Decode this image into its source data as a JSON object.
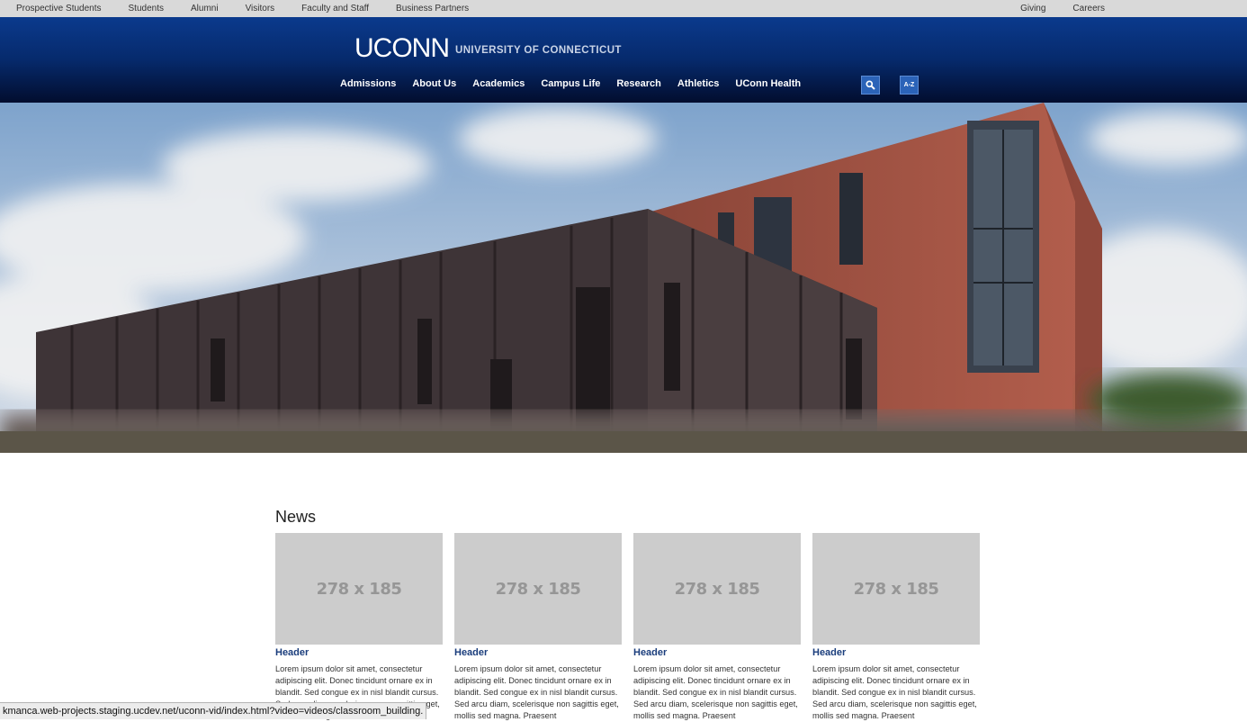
{
  "utility_nav": {
    "left": [
      "Prospective Students",
      "Students",
      "Alumni",
      "Visitors",
      "Faculty and Staff",
      "Business Partners"
    ],
    "right": [
      "Giving",
      "Careers"
    ]
  },
  "header": {
    "logo": "UCONN",
    "subtitle": "UNIVERSITY OF CONNECTICUT",
    "nav": [
      "Admissions",
      "About Us",
      "Academics",
      "Campus Life",
      "Research",
      "Athletics",
      "UConn Health"
    ],
    "az_label": "A-Z",
    "brand_color": "#062a6c"
  },
  "hero": {
    "image": "campus-building-photo"
  },
  "news": {
    "title": "News",
    "cards": [
      {
        "thumb": "278 x 185",
        "header": "Header",
        "text": "Lorem ipsum dolor sit amet, consectetur adipiscing elit. Donec tincidunt ornare ex in blandit. Sed congue ex in nisl blandit cursus. Sed arcu diam, scelerisque non sagittis eget, mollis sed magna. Praesent"
      },
      {
        "thumb": "278 x 185",
        "header": "Header",
        "text": "Lorem ipsum dolor sit amet, consectetur adipiscing elit. Donec tincidunt ornare ex in blandit. Sed congue ex in nisl blandit cursus. Sed arcu diam, scelerisque non sagittis eget, mollis sed magna. Praesent"
      },
      {
        "thumb": "278 x 185",
        "header": "Header",
        "text": "Lorem ipsum dolor sit amet, consectetur adipiscing elit. Donec tincidunt ornare ex in blandit. Sed congue ex in nisl blandit cursus. Sed arcu diam, scelerisque non sagittis eget, mollis sed magna. Praesent"
      },
      {
        "thumb": "278 x 185",
        "header": "Header",
        "text": "Lorem ipsum dolor sit amet, consectetur adipiscing elit. Donec tincidunt ornare ex in blandit. Sed congue ex in nisl blandit cursus. Sed arcu diam, scelerisque non sagittis eget, mollis sed magna. Praesent"
      }
    ]
  },
  "status_bar": {
    "url": "kmanca.web-projects.staging.ucdev.net/uconn-vid/index.html?video=videos/classroom_building."
  }
}
